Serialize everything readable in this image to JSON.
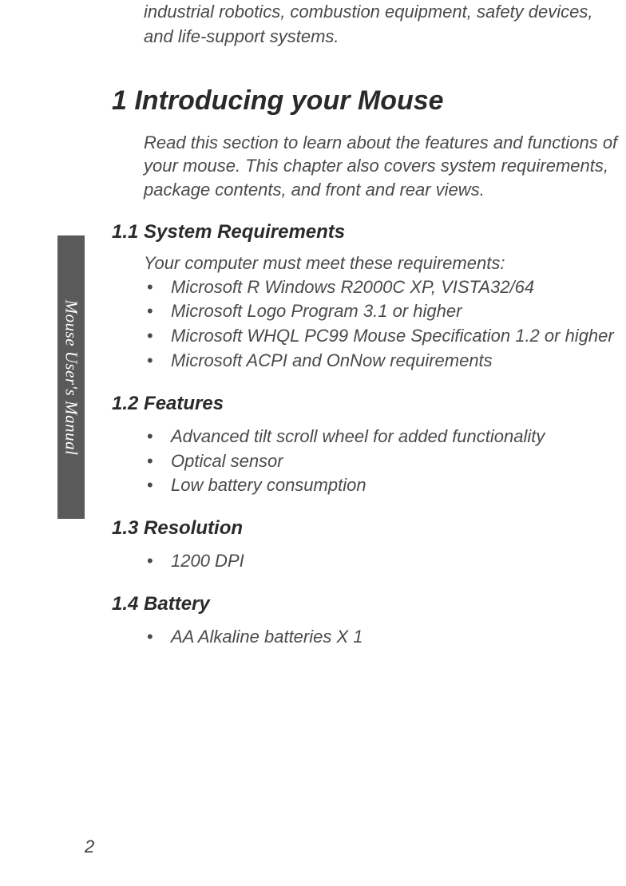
{
  "sideTab": "Mouse User's Manual",
  "pageNumber": "2",
  "introFragment": "industrial robotics, combustion equipment, safety devices, and life-support systems.",
  "h1": "1 Introducing your Mouse",
  "introPara": "Read this section to learn about the features and functions of your mouse. This chapter also covers system requirements, package contents, and front and rear views.",
  "sections": {
    "sysReq": {
      "heading": "1.1 System Requirements",
      "intro": "Your computer must meet these requirements:",
      "items": [
        "Microsoft R Windows R2000C XP, VISTA32/64",
        "Microsoft Logo Program 3.1 or higher",
        "Microsoft WHQL PC99 Mouse Specification 1.2 or higher",
        "Microsoft ACPI and OnNow requirements"
      ]
    },
    "features": {
      "heading": "1.2 Features",
      "items": [
        "Advanced tilt scroll wheel for added functionality",
        "Optical sensor",
        "Low battery consumption"
      ]
    },
    "resolution": {
      "heading": "1.3 Resolution",
      "items": [
        "1200 DPI"
      ]
    },
    "battery": {
      "heading": "1.4 Battery",
      "items": [
        "AA Alkaline batteries X 1"
      ]
    }
  }
}
